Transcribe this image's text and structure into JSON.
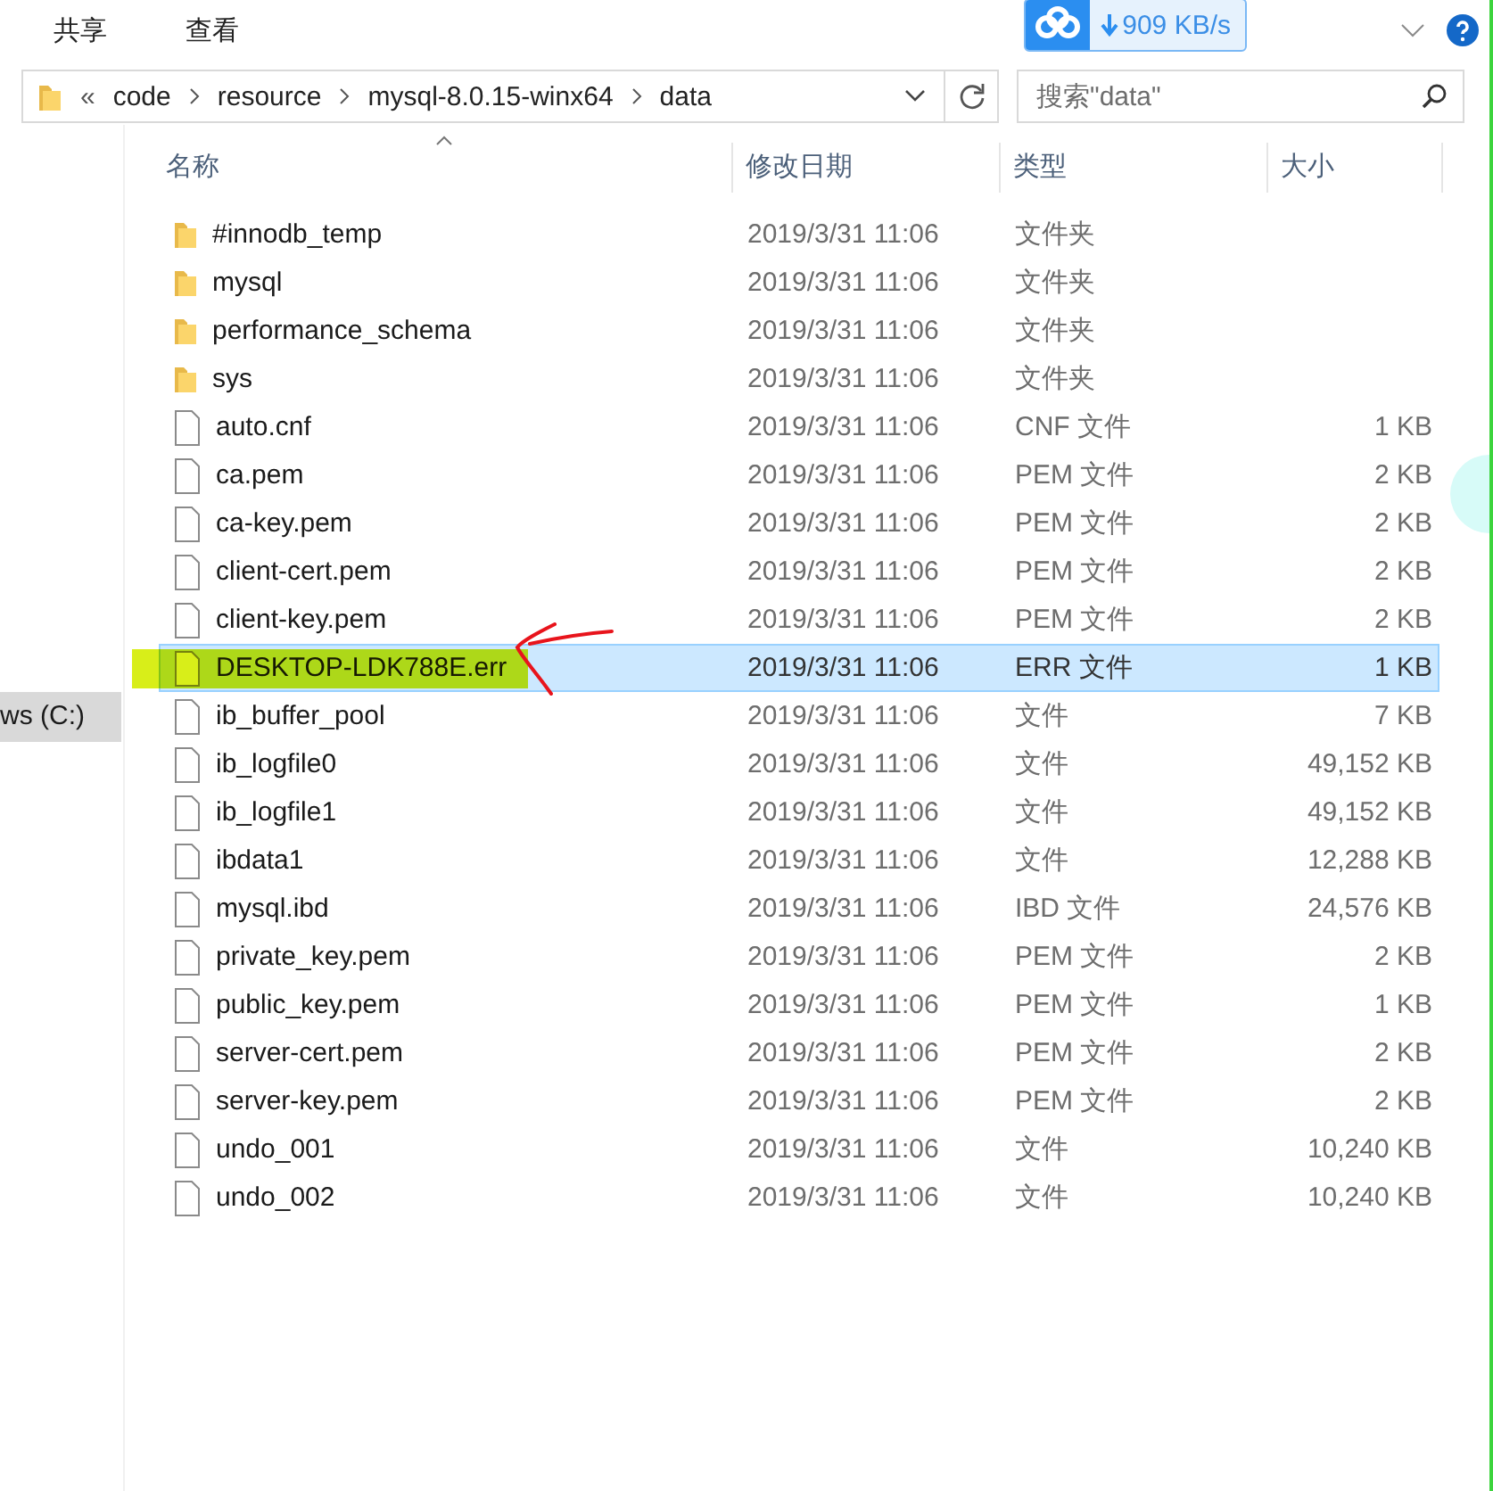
{
  "ribbon": {
    "tabs": [
      {
        "label": "共享"
      },
      {
        "label": "查看"
      }
    ],
    "download_speed": "909 KB/s"
  },
  "address": {
    "overflow": "«",
    "crumbs": [
      "code",
      "resource",
      "mysql-8.0.15-winx64",
      "data"
    ]
  },
  "search": {
    "placeholder": "搜索\"data\""
  },
  "sidebar": {
    "items": [
      {
        "label": "ws (C:)",
        "selected": true
      }
    ]
  },
  "table": {
    "columns": [
      "名称",
      "修改日期",
      "类型",
      "大小"
    ],
    "rows": [
      {
        "kind": "folder",
        "name": "#innodb_temp",
        "date": "2019/3/31 11:06",
        "type": "文件夹",
        "size": "",
        "selected": false,
        "annotated": false
      },
      {
        "kind": "folder",
        "name": "mysql",
        "date": "2019/3/31 11:06",
        "type": "文件夹",
        "size": "",
        "selected": false,
        "annotated": false
      },
      {
        "kind": "folder",
        "name": "performance_schema",
        "date": "2019/3/31 11:06",
        "type": "文件夹",
        "size": "",
        "selected": false,
        "annotated": false
      },
      {
        "kind": "folder",
        "name": "sys",
        "date": "2019/3/31 11:06",
        "type": "文件夹",
        "size": "",
        "selected": false,
        "annotated": false
      },
      {
        "kind": "file",
        "name": "auto.cnf",
        "date": "2019/3/31 11:06",
        "type": "CNF 文件",
        "size": "1 KB",
        "selected": false,
        "annotated": false
      },
      {
        "kind": "file",
        "name": "ca.pem",
        "date": "2019/3/31 11:06",
        "type": "PEM 文件",
        "size": "2 KB",
        "selected": false,
        "annotated": false
      },
      {
        "kind": "file",
        "name": "ca-key.pem",
        "date": "2019/3/31 11:06",
        "type": "PEM 文件",
        "size": "2 KB",
        "selected": false,
        "annotated": false
      },
      {
        "kind": "file",
        "name": "client-cert.pem",
        "date": "2019/3/31 11:06",
        "type": "PEM 文件",
        "size": "2 KB",
        "selected": false,
        "annotated": false
      },
      {
        "kind": "file",
        "name": "client-key.pem",
        "date": "2019/3/31 11:06",
        "type": "PEM 文件",
        "size": "2 KB",
        "selected": false,
        "annotated": false
      },
      {
        "kind": "file",
        "name": "DESKTOP-LDK788E.err",
        "date": "2019/3/31 11:06",
        "type": "ERR 文件",
        "size": "1 KB",
        "selected": true,
        "annotated": true
      },
      {
        "kind": "file",
        "name": "ib_buffer_pool",
        "date": "2019/3/31 11:06",
        "type": "文件",
        "size": "7 KB",
        "selected": false,
        "annotated": false
      },
      {
        "kind": "file",
        "name": "ib_logfile0",
        "date": "2019/3/31 11:06",
        "type": "文件",
        "size": "49,152 KB",
        "selected": false,
        "annotated": false
      },
      {
        "kind": "file",
        "name": "ib_logfile1",
        "date": "2019/3/31 11:06",
        "type": "文件",
        "size": "49,152 KB",
        "selected": false,
        "annotated": false
      },
      {
        "kind": "file",
        "name": "ibdata1",
        "date": "2019/3/31 11:06",
        "type": "文件",
        "size": "12,288 KB",
        "selected": false,
        "annotated": false
      },
      {
        "kind": "file",
        "name": "mysql.ibd",
        "date": "2019/3/31 11:06",
        "type": "IBD 文件",
        "size": "24,576 KB",
        "selected": false,
        "annotated": false
      },
      {
        "kind": "file",
        "name": "private_key.pem",
        "date": "2019/3/31 11:06",
        "type": "PEM 文件",
        "size": "2 KB",
        "selected": false,
        "annotated": false
      },
      {
        "kind": "file",
        "name": "public_key.pem",
        "date": "2019/3/31 11:06",
        "type": "PEM 文件",
        "size": "1 KB",
        "selected": false,
        "annotated": false
      },
      {
        "kind": "file",
        "name": "server-cert.pem",
        "date": "2019/3/31 11:06",
        "type": "PEM 文件",
        "size": "2 KB",
        "selected": false,
        "annotated": false
      },
      {
        "kind": "file",
        "name": "server-key.pem",
        "date": "2019/3/31 11:06",
        "type": "PEM 文件",
        "size": "2 KB",
        "selected": false,
        "annotated": false
      },
      {
        "kind": "file",
        "name": "undo_001",
        "date": "2019/3/31 11:06",
        "type": "文件",
        "size": "10,240 KB",
        "selected": false,
        "annotated": false
      },
      {
        "kind": "file",
        "name": "undo_002",
        "date": "2019/3/31 11:06",
        "type": "文件",
        "size": "10,240 KB",
        "selected": false,
        "annotated": false
      }
    ]
  }
}
